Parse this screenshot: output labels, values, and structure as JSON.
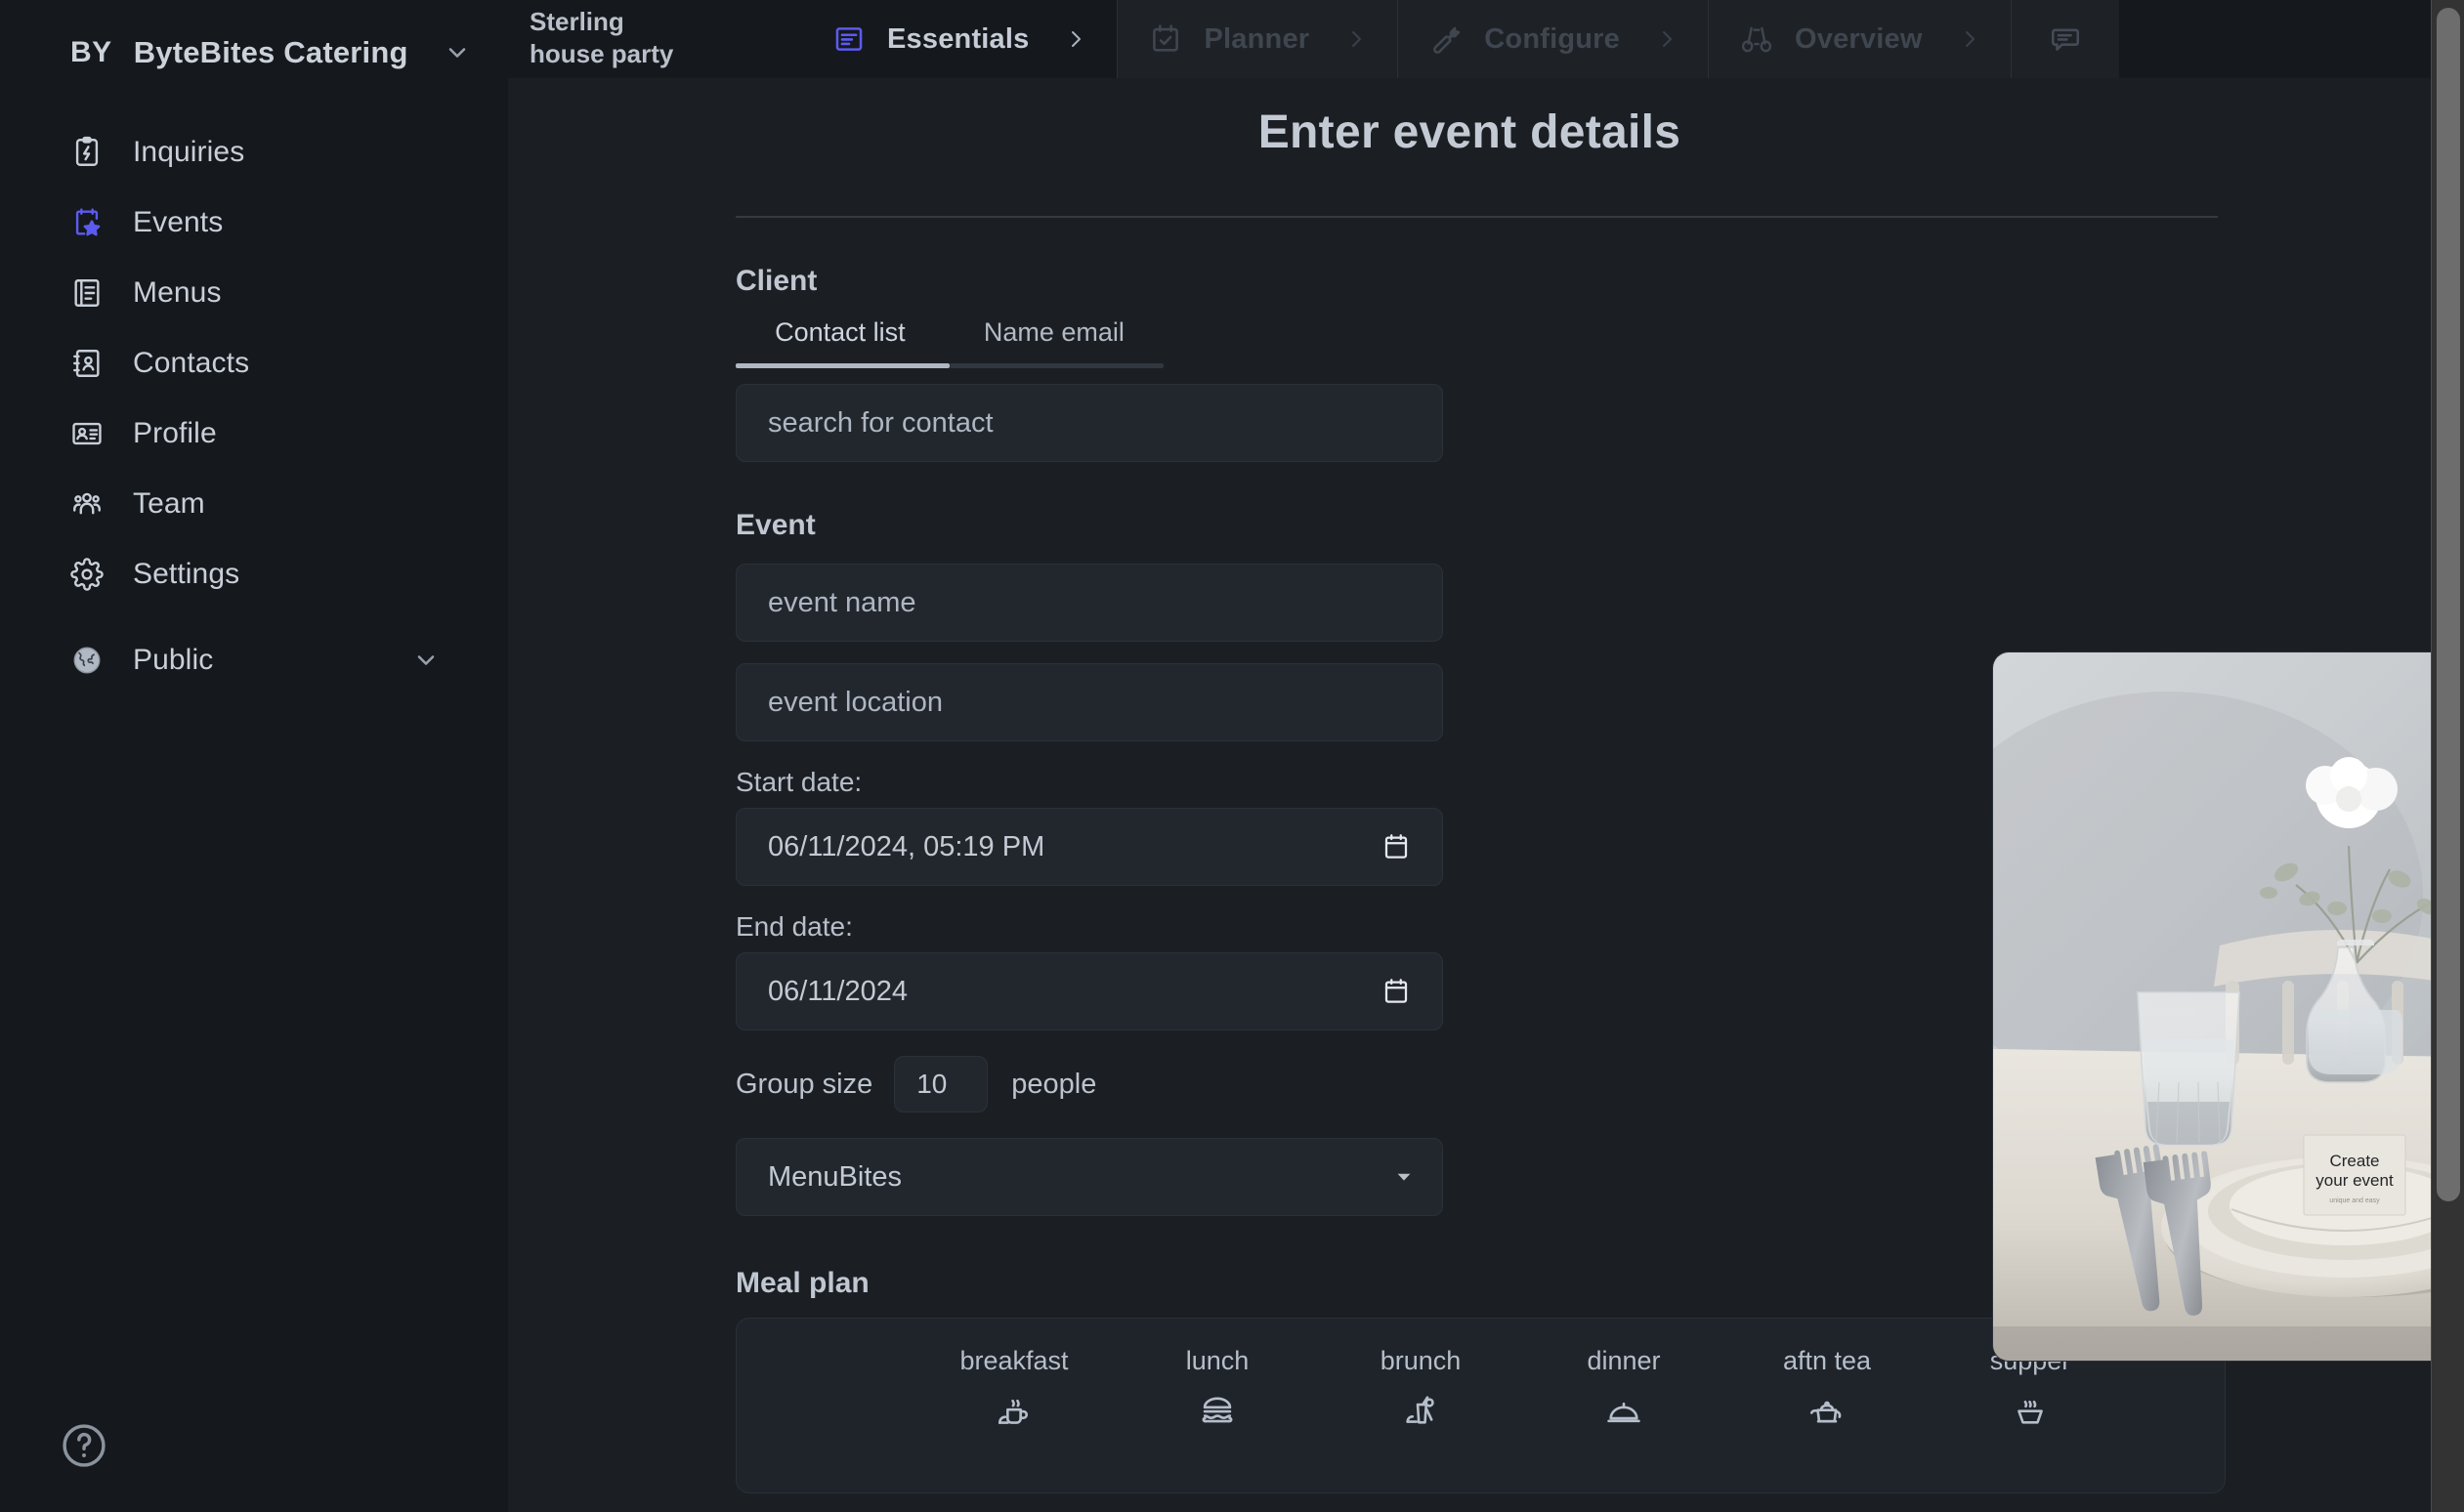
{
  "brand": {
    "mark": "BY",
    "name": "ByteBites Catering"
  },
  "sidebar": {
    "items": [
      {
        "label": "Inquiries",
        "icon": "clipboard-lightning-icon"
      },
      {
        "label": "Events",
        "icon": "calendar-star-icon"
      },
      {
        "label": "Menus",
        "icon": "book-icon"
      },
      {
        "label": "Contacts",
        "icon": "contact-card-icon"
      },
      {
        "label": "Profile",
        "icon": "id-badge-icon"
      },
      {
        "label": "Team",
        "icon": "people-icon"
      },
      {
        "label": "Settings",
        "icon": "gear-icon"
      }
    ],
    "public": {
      "label": "Public",
      "icon": "globe-icon"
    },
    "help": {
      "icon": "help-circle-icon"
    }
  },
  "topbar": {
    "event_title": "Sterling house party",
    "tabs": [
      {
        "label": "Essentials",
        "icon": "document-lines-icon",
        "state": "active"
      },
      {
        "label": "Planner",
        "icon": "calendar-check-icon",
        "state": "disabled"
      },
      {
        "label": "Configure",
        "icon": "wrench-icon",
        "state": "disabled"
      },
      {
        "label": "Overview",
        "icon": "binoculars-icon",
        "state": "disabled"
      },
      {
        "label": "",
        "icon": "chat-bubble-icon",
        "state": "disabled"
      }
    ],
    "chevron": "›"
  },
  "page": {
    "title": "Enter event details"
  },
  "client": {
    "section_label": "Client",
    "tabs": [
      {
        "label": "Contact list",
        "active": true
      },
      {
        "label": "Name email",
        "active": false
      }
    ],
    "search_placeholder": "search for contact"
  },
  "event": {
    "section_label": "Event",
    "name_placeholder": "event name",
    "location_placeholder": "event location",
    "start_label": "Start date:",
    "start_value": "06/11/2024, 05:19 PM",
    "end_label": "End date:",
    "end_value": "06/11/2024",
    "group_label": "Group size",
    "group_value": "10",
    "group_unit": "people",
    "menu_select_value": "MenuBites",
    "calendar_icon": "calendar-picker-icon",
    "dropdown_icon": "chevron-down-icon"
  },
  "meal_plan": {
    "title": "Meal plan",
    "options": [
      {
        "label": "breakfast",
        "icon": "coffee-croissant-icon"
      },
      {
        "label": "lunch",
        "icon": "burger-icon"
      },
      {
        "label": "brunch",
        "icon": "juice-glass-icon"
      },
      {
        "label": "dinner",
        "icon": "cloche-icon"
      },
      {
        "label": "aftn tea",
        "icon": "teapot-icon"
      },
      {
        "label": "supper",
        "icon": "soup-bowl-icon"
      }
    ]
  },
  "hero_image": {
    "alt": "table setting with vase and place card",
    "card_line1": "Create",
    "card_line2": "your event"
  },
  "colors": {
    "bg_sidebar": "#15181c",
    "bg_main": "#1b1f24",
    "accent": "#5b5bf0",
    "text_primary": "#c3cad4",
    "text_muted": "#6b737d",
    "field_bg": "#22272e"
  }
}
